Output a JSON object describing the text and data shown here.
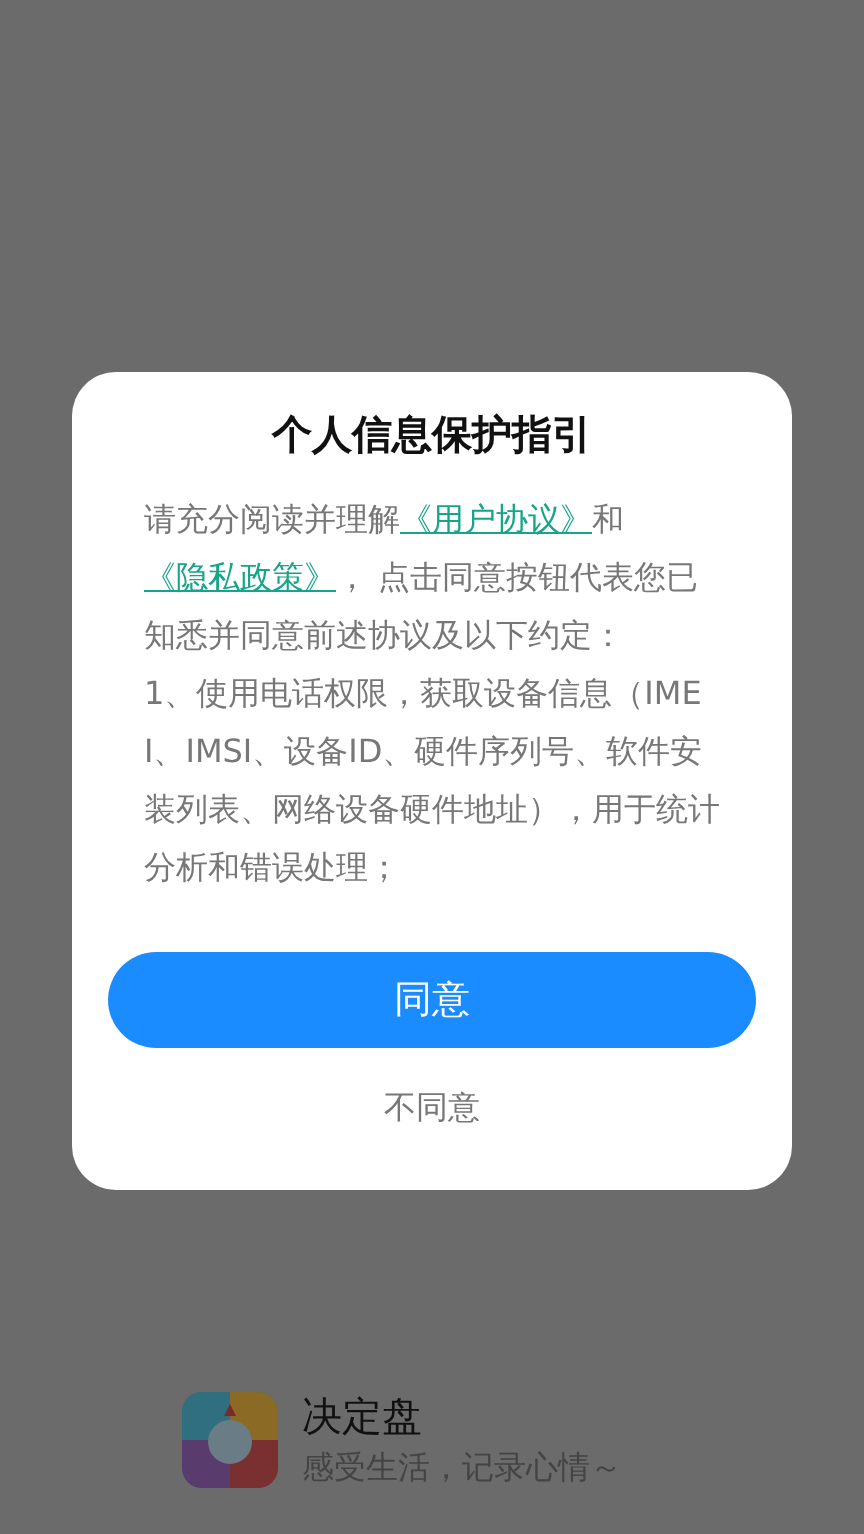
{
  "dialog": {
    "title": "个人信息保护指引",
    "body": {
      "intro": "请充分阅读并理解",
      "link_terms": "《用户协议》",
      "joiner": "和",
      "link_privacy": "《隐私政策》",
      "rest": "， 点击同意按钮代表您已知悉并同意前述协议及以下约定：",
      "item": " 1、使用电话权限，获取设备信息（IMEI、IMSI、设备ID、硬件序列号、软件安装列表、网络设备硬件地址），用于统计分析和错误处理；"
    },
    "agree": "同意",
    "decline": "不同意"
  },
  "splash": {
    "app_name": "决定盘",
    "slogan": "感受生活，记录心情～"
  }
}
